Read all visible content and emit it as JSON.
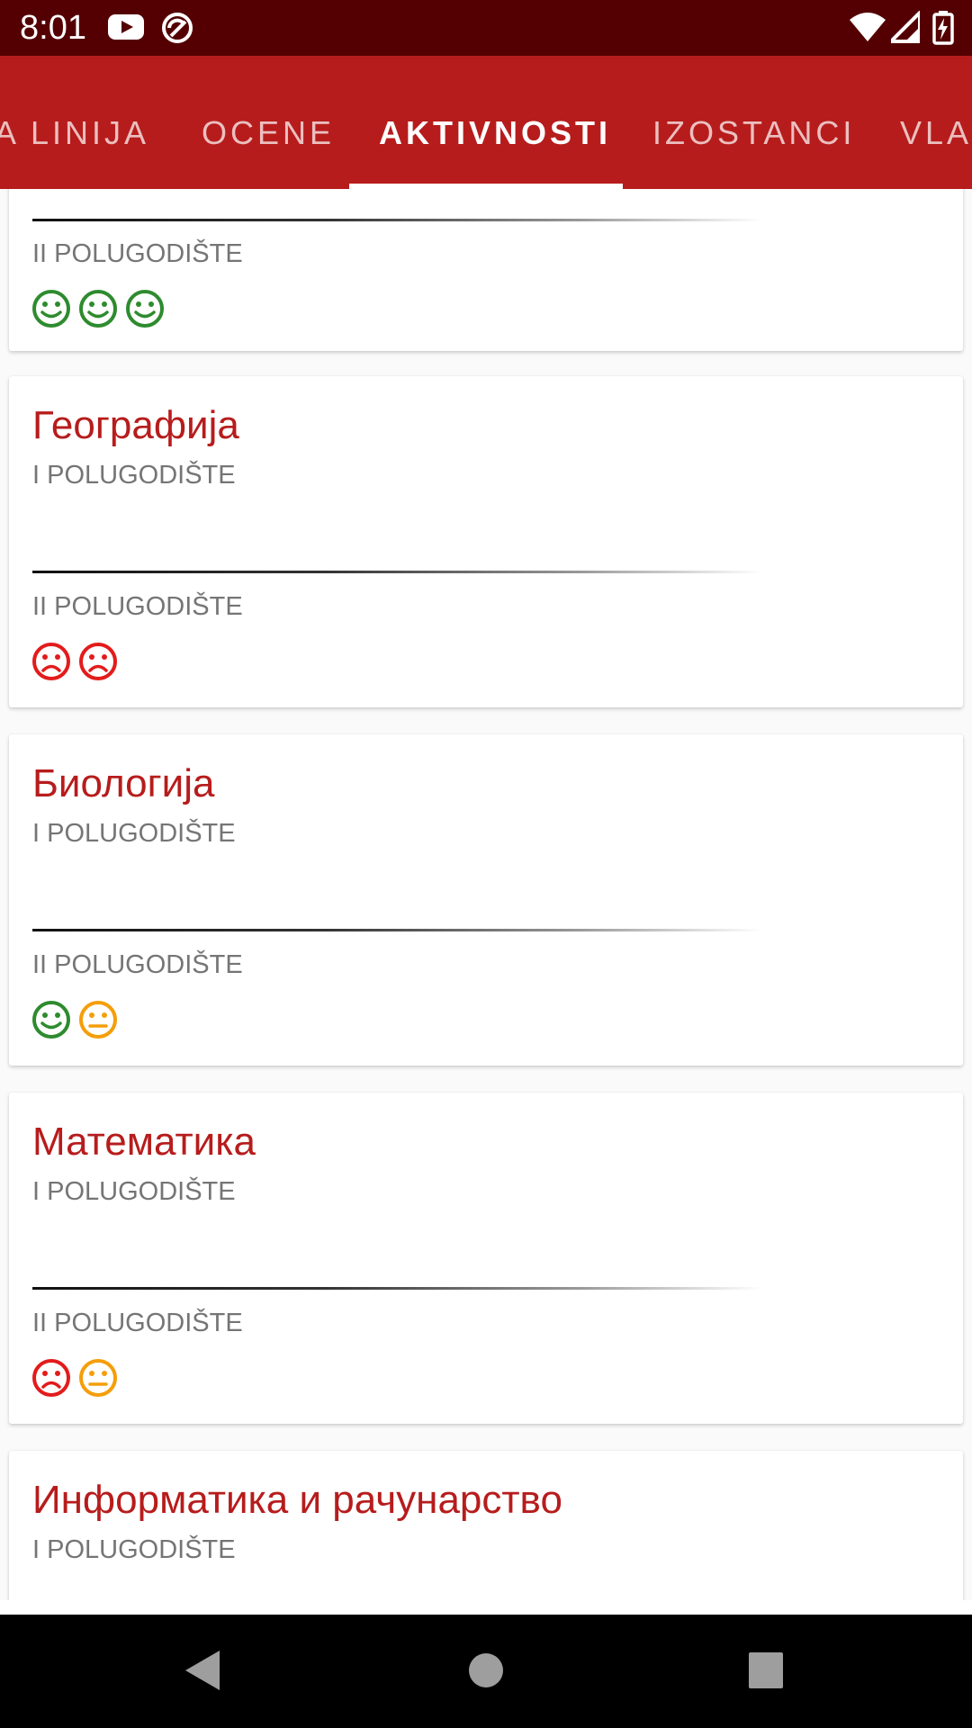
{
  "status_bar": {
    "time": "8:01",
    "left_icons": [
      "youtube-icon",
      "sync-icon"
    ],
    "right_icons": [
      "wifi-icon",
      "cell-signal-icon",
      "battery-charging-icon"
    ]
  },
  "tabs": [
    {
      "label": "A LINIJA",
      "active": false
    },
    {
      "label": "OCENE",
      "active": false
    },
    {
      "label": "AKTIVNOSTI",
      "active": true
    },
    {
      "label": "IZOSTANCI",
      "active": false
    },
    {
      "label": "VLA",
      "active": false
    }
  ],
  "cards": [
    {
      "subject": "",
      "periods": [
        {
          "label": "II POLUGODIŠTE",
          "smileys": [
            "happy",
            "happy",
            "happy"
          ]
        }
      ]
    },
    {
      "subject": "Географија",
      "periods": [
        {
          "label": "I POLUGODIŠTE",
          "smileys": []
        },
        {
          "label": "II POLUGODIŠTE",
          "smileys": [
            "sad",
            "sad"
          ]
        }
      ]
    },
    {
      "subject": "Биологија",
      "periods": [
        {
          "label": "I POLUGODIŠTE",
          "smileys": []
        },
        {
          "label": "II POLUGODIŠTE",
          "smileys": [
            "happy",
            "neutral"
          ]
        }
      ]
    },
    {
      "subject": "Математика",
      "periods": [
        {
          "label": "I POLUGODIŠTE",
          "smileys": []
        },
        {
          "label": "II POLUGODIŠTE",
          "smileys": [
            "sad",
            "neutral"
          ]
        }
      ]
    },
    {
      "subject": "Информатика и рачунарство",
      "periods": [
        {
          "label": "I POLUGODIŠTE",
          "smileys": []
        }
      ]
    }
  ],
  "colors": {
    "status_bar": "#540002",
    "app_bar": "#b71c1c",
    "subject_text": "#b71c1c",
    "happy": "#2e8b2e",
    "neutral": "#f59e0b",
    "sad": "#e31b1b"
  },
  "nav_bar": {
    "buttons": [
      "back-icon",
      "home-icon",
      "recents-icon"
    ]
  }
}
